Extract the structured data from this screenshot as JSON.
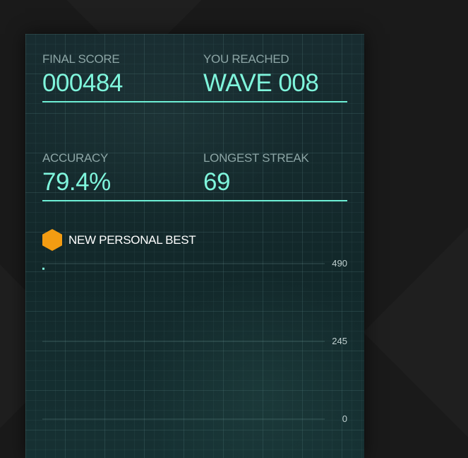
{
  "stats": {
    "final_score": {
      "label": "FINAL SCORE",
      "value": "000484"
    },
    "wave": {
      "label": "YOU REACHED",
      "value": "WAVE 008"
    },
    "accuracy": {
      "label": "ACCURACY",
      "value": "79.4%"
    },
    "streak": {
      "label": "LONGEST STREAK",
      "value": "69"
    }
  },
  "personal_best": {
    "text": "NEW PERSONAL BEST",
    "icon": "hexagon-icon",
    "color": "#f39c12"
  },
  "colors": {
    "accent": "#7ff5dc",
    "panel": "#132528"
  },
  "chart_data": {
    "type": "line",
    "title": "",
    "xlabel": "",
    "ylabel": "",
    "y_ticks": [
      "490",
      "245",
      "0"
    ],
    "ylim": [
      0,
      490
    ],
    "grid": true,
    "series": [
      {
        "x": [
          0
        ],
        "y": [
          484
        ]
      }
    ]
  }
}
